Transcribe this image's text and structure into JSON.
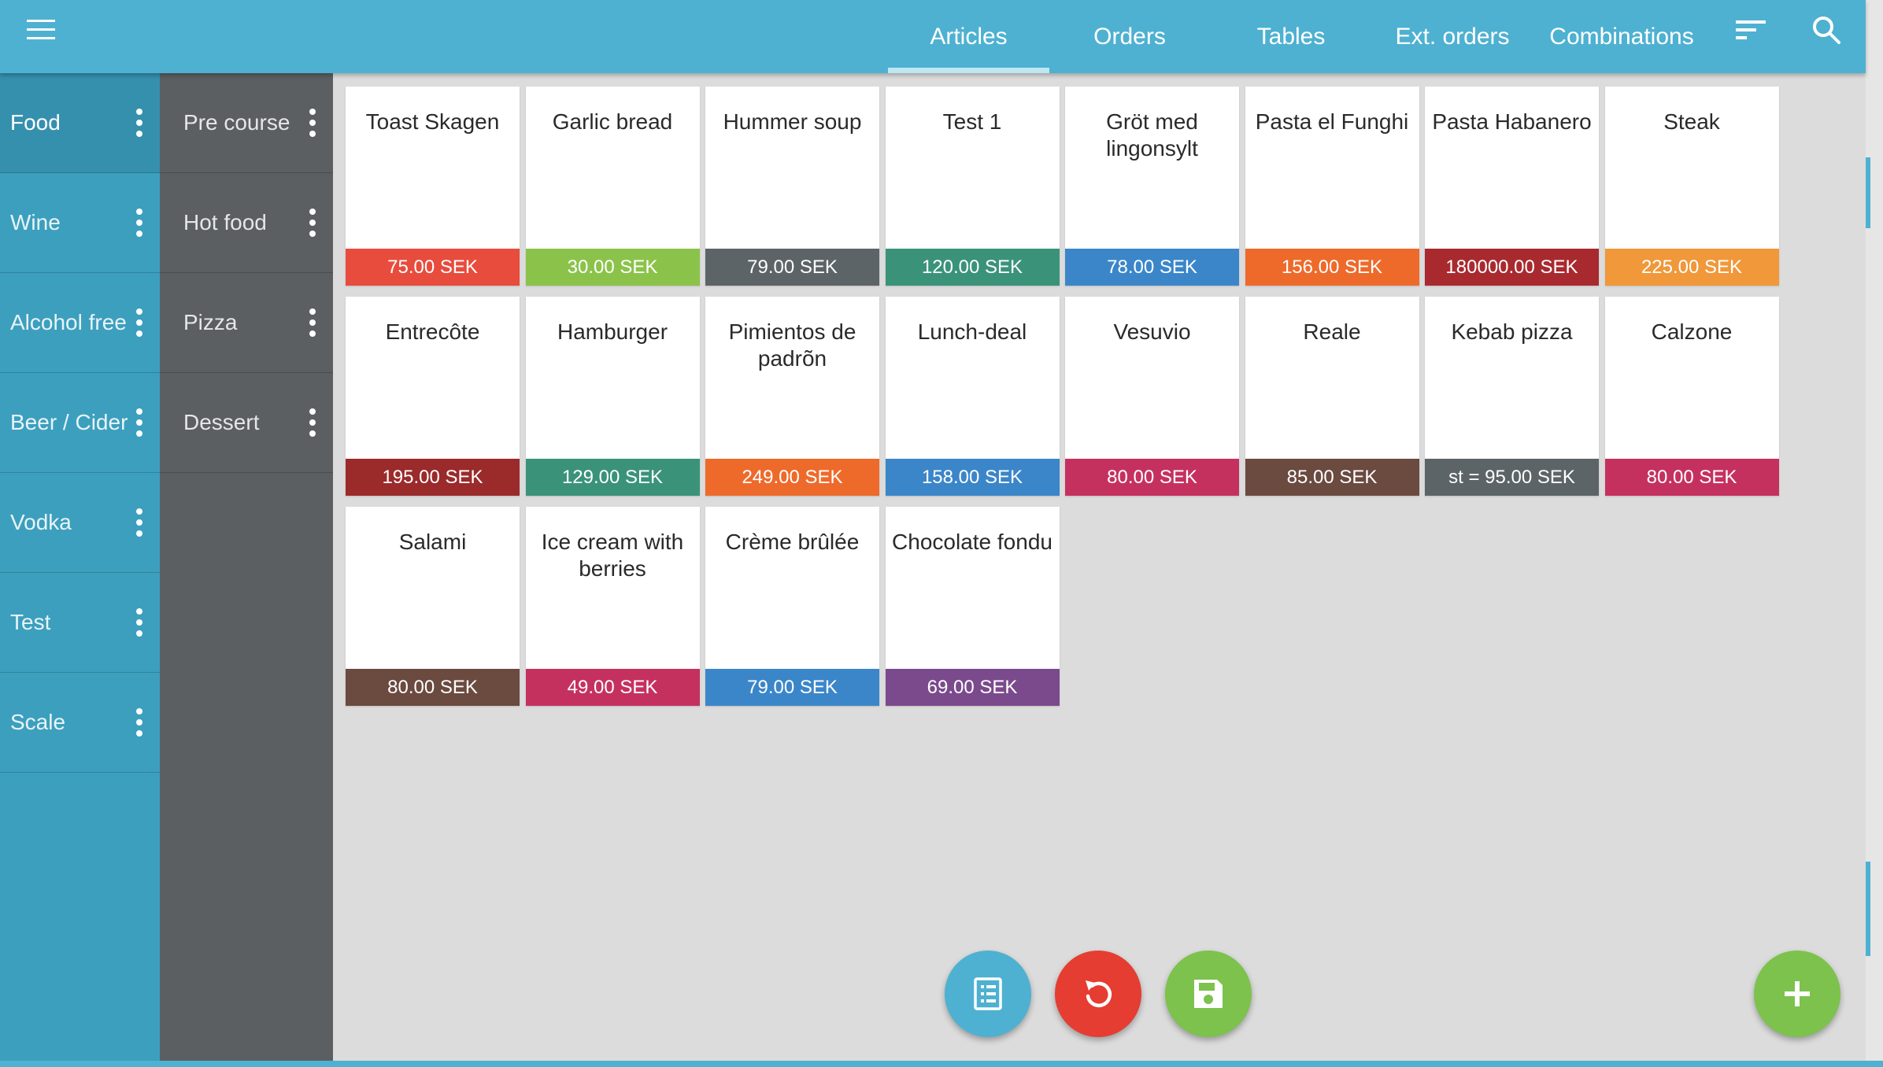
{
  "colors": {
    "topbar": "#4eb1d1",
    "sidebar_primary": "#3c9fbe",
    "sidebar_secondary": "#5b5f62",
    "background": "#dcdcdc"
  },
  "header": {
    "menu_icon": "hamburger-menu-icon",
    "tabs": [
      {
        "label": "Articles",
        "active": true
      },
      {
        "label": "Orders"
      },
      {
        "label": "Tables"
      },
      {
        "label": "Ext. orders"
      },
      {
        "label": "Combinations"
      }
    ],
    "filter_icon": "sort-filter-icon",
    "search_icon": "search-icon"
  },
  "main_categories": [
    {
      "label": "Food",
      "active": true
    },
    {
      "label": "Wine"
    },
    {
      "label": "Alcohol free"
    },
    {
      "label": "Beer / Cider"
    },
    {
      "label": "Vodka"
    },
    {
      "label": "Test"
    },
    {
      "label": "Scale"
    }
  ],
  "sub_categories": [
    {
      "label": "Pre course"
    },
    {
      "label": "Hot food"
    },
    {
      "label": "Pizza"
    },
    {
      "label": "Dessert"
    }
  ],
  "articles": [
    {
      "name": "Toast Skagen",
      "price": "75.00 SEK",
      "color": "#e84c3d"
    },
    {
      "name": "Garlic bread",
      "price": "30.00 SEK",
      "color": "#8bc34a"
    },
    {
      "name": "Hummer soup",
      "price": "79.00 SEK",
      "color": "#5d6467"
    },
    {
      "name": "Test 1",
      "price": "120.00 SEK",
      "color": "#3a9379"
    },
    {
      "name": "Gröt med lingonsylt",
      "price": "78.00 SEK",
      "color": "#3b86c9"
    },
    {
      "name": "Pasta el Funghi",
      "price": "156.00 SEK",
      "color": "#ee6a2b"
    },
    {
      "name": "Pasta Habanero",
      "price": "180000.00 SEK",
      "color": "#a82a2f"
    },
    {
      "name": "Steak",
      "price": "225.00 SEK",
      "color": "#f0983a"
    },
    {
      "name": "Entrecôte",
      "price": "195.00 SEK",
      "color": "#9b2a2b"
    },
    {
      "name": "Hamburger",
      "price": "129.00 SEK",
      "color": "#3a9379"
    },
    {
      "name": "Pimientos de padrõn",
      "price": "249.00 SEK",
      "color": "#ee6a2b"
    },
    {
      "name": "Lunch-deal",
      "price": "158.00 SEK",
      "color": "#3b86c9"
    },
    {
      "name": "Vesuvio",
      "price": "80.00 SEK",
      "color": "#c5315f"
    },
    {
      "name": "Reale",
      "price": "85.00 SEK",
      "color": "#6b4a40"
    },
    {
      "name": "Kebab pizza",
      "price": "st = 95.00 SEK",
      "color": "#5d6467"
    },
    {
      "name": "Calzone",
      "price": "80.00 SEK",
      "color": "#c5315f"
    },
    {
      "name": "Salami",
      "price": "80.00 SEK",
      "color": "#6b4a40"
    },
    {
      "name": "Ice cream with berries",
      "price": "49.00 SEK",
      "color": "#c5315f"
    },
    {
      "name": "Crème brûlée",
      "price": "79.00 SEK",
      "color": "#3b86c9"
    },
    {
      "name": "Chocolate fondu",
      "price": "69.00 SEK",
      "color": "#7b4a8c"
    }
  ],
  "fabs": [
    {
      "icon": "receipt-icon",
      "color": "#4eb1d1"
    },
    {
      "icon": "undo-icon",
      "color": "#e53d31"
    },
    {
      "icon": "save-icon",
      "color": "#7cc24d"
    },
    {
      "icon": "add-icon",
      "color": "#7cc24d"
    }
  ]
}
